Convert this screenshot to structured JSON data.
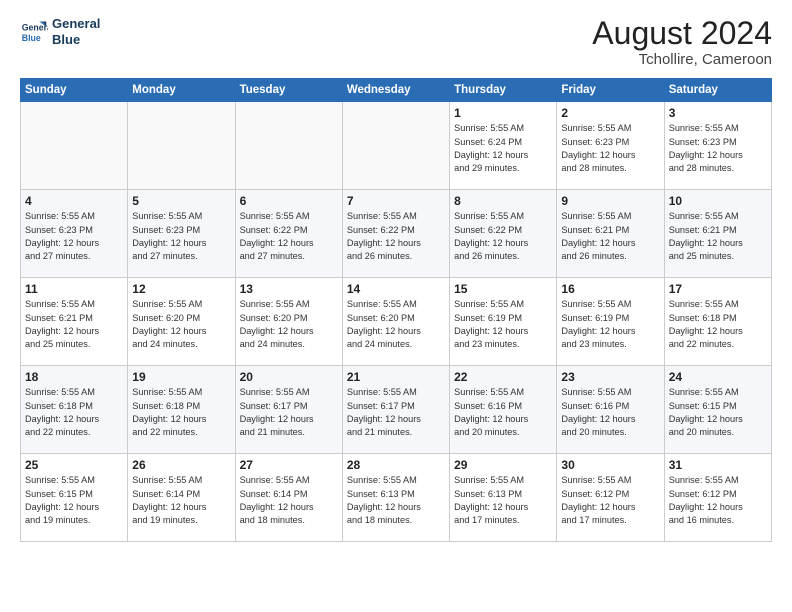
{
  "header": {
    "logo_line1": "General",
    "logo_line2": "Blue",
    "month": "August 2024",
    "location": "Tchollire, Cameroon"
  },
  "weekdays": [
    "Sunday",
    "Monday",
    "Tuesday",
    "Wednesday",
    "Thursday",
    "Friday",
    "Saturday"
  ],
  "weeks": [
    [
      {
        "day": "",
        "info": ""
      },
      {
        "day": "",
        "info": ""
      },
      {
        "day": "",
        "info": ""
      },
      {
        "day": "",
        "info": ""
      },
      {
        "day": "1",
        "info": "Sunrise: 5:55 AM\nSunset: 6:24 PM\nDaylight: 12 hours\nand 29 minutes."
      },
      {
        "day": "2",
        "info": "Sunrise: 5:55 AM\nSunset: 6:23 PM\nDaylight: 12 hours\nand 28 minutes."
      },
      {
        "day": "3",
        "info": "Sunrise: 5:55 AM\nSunset: 6:23 PM\nDaylight: 12 hours\nand 28 minutes."
      }
    ],
    [
      {
        "day": "4",
        "info": "Sunrise: 5:55 AM\nSunset: 6:23 PM\nDaylight: 12 hours\nand 27 minutes."
      },
      {
        "day": "5",
        "info": "Sunrise: 5:55 AM\nSunset: 6:23 PM\nDaylight: 12 hours\nand 27 minutes."
      },
      {
        "day": "6",
        "info": "Sunrise: 5:55 AM\nSunset: 6:22 PM\nDaylight: 12 hours\nand 27 minutes."
      },
      {
        "day": "7",
        "info": "Sunrise: 5:55 AM\nSunset: 6:22 PM\nDaylight: 12 hours\nand 26 minutes."
      },
      {
        "day": "8",
        "info": "Sunrise: 5:55 AM\nSunset: 6:22 PM\nDaylight: 12 hours\nand 26 minutes."
      },
      {
        "day": "9",
        "info": "Sunrise: 5:55 AM\nSunset: 6:21 PM\nDaylight: 12 hours\nand 26 minutes."
      },
      {
        "day": "10",
        "info": "Sunrise: 5:55 AM\nSunset: 6:21 PM\nDaylight: 12 hours\nand 25 minutes."
      }
    ],
    [
      {
        "day": "11",
        "info": "Sunrise: 5:55 AM\nSunset: 6:21 PM\nDaylight: 12 hours\nand 25 minutes."
      },
      {
        "day": "12",
        "info": "Sunrise: 5:55 AM\nSunset: 6:20 PM\nDaylight: 12 hours\nand 24 minutes."
      },
      {
        "day": "13",
        "info": "Sunrise: 5:55 AM\nSunset: 6:20 PM\nDaylight: 12 hours\nand 24 minutes."
      },
      {
        "day": "14",
        "info": "Sunrise: 5:55 AM\nSunset: 6:20 PM\nDaylight: 12 hours\nand 24 minutes."
      },
      {
        "day": "15",
        "info": "Sunrise: 5:55 AM\nSunset: 6:19 PM\nDaylight: 12 hours\nand 23 minutes."
      },
      {
        "day": "16",
        "info": "Sunrise: 5:55 AM\nSunset: 6:19 PM\nDaylight: 12 hours\nand 23 minutes."
      },
      {
        "day": "17",
        "info": "Sunrise: 5:55 AM\nSunset: 6:18 PM\nDaylight: 12 hours\nand 22 minutes."
      }
    ],
    [
      {
        "day": "18",
        "info": "Sunrise: 5:55 AM\nSunset: 6:18 PM\nDaylight: 12 hours\nand 22 minutes."
      },
      {
        "day": "19",
        "info": "Sunrise: 5:55 AM\nSunset: 6:18 PM\nDaylight: 12 hours\nand 22 minutes."
      },
      {
        "day": "20",
        "info": "Sunrise: 5:55 AM\nSunset: 6:17 PM\nDaylight: 12 hours\nand 21 minutes."
      },
      {
        "day": "21",
        "info": "Sunrise: 5:55 AM\nSunset: 6:17 PM\nDaylight: 12 hours\nand 21 minutes."
      },
      {
        "day": "22",
        "info": "Sunrise: 5:55 AM\nSunset: 6:16 PM\nDaylight: 12 hours\nand 20 minutes."
      },
      {
        "day": "23",
        "info": "Sunrise: 5:55 AM\nSunset: 6:16 PM\nDaylight: 12 hours\nand 20 minutes."
      },
      {
        "day": "24",
        "info": "Sunrise: 5:55 AM\nSunset: 6:15 PM\nDaylight: 12 hours\nand 20 minutes."
      }
    ],
    [
      {
        "day": "25",
        "info": "Sunrise: 5:55 AM\nSunset: 6:15 PM\nDaylight: 12 hours\nand 19 minutes."
      },
      {
        "day": "26",
        "info": "Sunrise: 5:55 AM\nSunset: 6:14 PM\nDaylight: 12 hours\nand 19 minutes."
      },
      {
        "day": "27",
        "info": "Sunrise: 5:55 AM\nSunset: 6:14 PM\nDaylight: 12 hours\nand 18 minutes."
      },
      {
        "day": "28",
        "info": "Sunrise: 5:55 AM\nSunset: 6:13 PM\nDaylight: 12 hours\nand 18 minutes."
      },
      {
        "day": "29",
        "info": "Sunrise: 5:55 AM\nSunset: 6:13 PM\nDaylight: 12 hours\nand 17 minutes."
      },
      {
        "day": "30",
        "info": "Sunrise: 5:55 AM\nSunset: 6:12 PM\nDaylight: 12 hours\nand 17 minutes."
      },
      {
        "day": "31",
        "info": "Sunrise: 5:55 AM\nSunset: 6:12 PM\nDaylight: 12 hours\nand 16 minutes."
      }
    ]
  ]
}
